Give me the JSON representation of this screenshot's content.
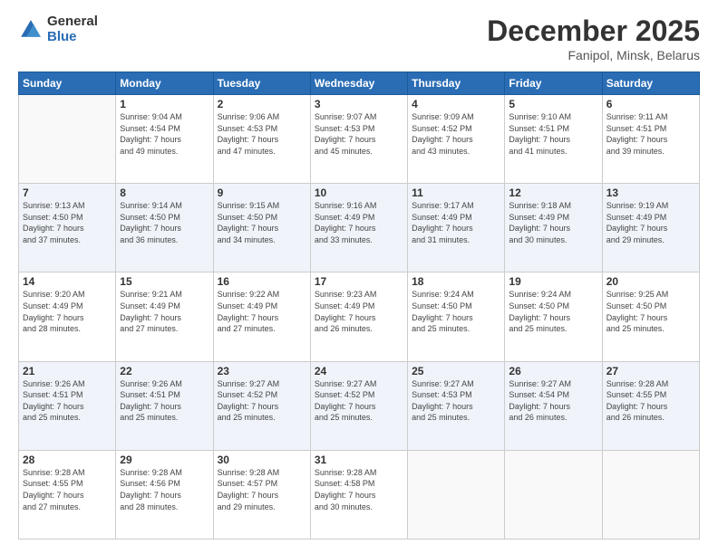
{
  "logo": {
    "general": "General",
    "blue": "Blue"
  },
  "header": {
    "month": "December 2025",
    "location": "Fanipol, Minsk, Belarus"
  },
  "weekdays": [
    "Sunday",
    "Monday",
    "Tuesday",
    "Wednesday",
    "Thursday",
    "Friday",
    "Saturday"
  ],
  "weeks": [
    [
      {
        "day": "",
        "info": ""
      },
      {
        "day": "1",
        "info": "Sunrise: 9:04 AM\nSunset: 4:54 PM\nDaylight: 7 hours\nand 49 minutes."
      },
      {
        "day": "2",
        "info": "Sunrise: 9:06 AM\nSunset: 4:53 PM\nDaylight: 7 hours\nand 47 minutes."
      },
      {
        "day": "3",
        "info": "Sunrise: 9:07 AM\nSunset: 4:53 PM\nDaylight: 7 hours\nand 45 minutes."
      },
      {
        "day": "4",
        "info": "Sunrise: 9:09 AM\nSunset: 4:52 PM\nDaylight: 7 hours\nand 43 minutes."
      },
      {
        "day": "5",
        "info": "Sunrise: 9:10 AM\nSunset: 4:51 PM\nDaylight: 7 hours\nand 41 minutes."
      },
      {
        "day": "6",
        "info": "Sunrise: 9:11 AM\nSunset: 4:51 PM\nDaylight: 7 hours\nand 39 minutes."
      }
    ],
    [
      {
        "day": "7",
        "info": "Sunrise: 9:13 AM\nSunset: 4:50 PM\nDaylight: 7 hours\nand 37 minutes."
      },
      {
        "day": "8",
        "info": "Sunrise: 9:14 AM\nSunset: 4:50 PM\nDaylight: 7 hours\nand 36 minutes."
      },
      {
        "day": "9",
        "info": "Sunrise: 9:15 AM\nSunset: 4:50 PM\nDaylight: 7 hours\nand 34 minutes."
      },
      {
        "day": "10",
        "info": "Sunrise: 9:16 AM\nSunset: 4:49 PM\nDaylight: 7 hours\nand 33 minutes."
      },
      {
        "day": "11",
        "info": "Sunrise: 9:17 AM\nSunset: 4:49 PM\nDaylight: 7 hours\nand 31 minutes."
      },
      {
        "day": "12",
        "info": "Sunrise: 9:18 AM\nSunset: 4:49 PM\nDaylight: 7 hours\nand 30 minutes."
      },
      {
        "day": "13",
        "info": "Sunrise: 9:19 AM\nSunset: 4:49 PM\nDaylight: 7 hours\nand 29 minutes."
      }
    ],
    [
      {
        "day": "14",
        "info": "Sunrise: 9:20 AM\nSunset: 4:49 PM\nDaylight: 7 hours\nand 28 minutes."
      },
      {
        "day": "15",
        "info": "Sunrise: 9:21 AM\nSunset: 4:49 PM\nDaylight: 7 hours\nand 27 minutes."
      },
      {
        "day": "16",
        "info": "Sunrise: 9:22 AM\nSunset: 4:49 PM\nDaylight: 7 hours\nand 27 minutes."
      },
      {
        "day": "17",
        "info": "Sunrise: 9:23 AM\nSunset: 4:49 PM\nDaylight: 7 hours\nand 26 minutes."
      },
      {
        "day": "18",
        "info": "Sunrise: 9:24 AM\nSunset: 4:50 PM\nDaylight: 7 hours\nand 25 minutes."
      },
      {
        "day": "19",
        "info": "Sunrise: 9:24 AM\nSunset: 4:50 PM\nDaylight: 7 hours\nand 25 minutes."
      },
      {
        "day": "20",
        "info": "Sunrise: 9:25 AM\nSunset: 4:50 PM\nDaylight: 7 hours\nand 25 minutes."
      }
    ],
    [
      {
        "day": "21",
        "info": "Sunrise: 9:26 AM\nSunset: 4:51 PM\nDaylight: 7 hours\nand 25 minutes."
      },
      {
        "day": "22",
        "info": "Sunrise: 9:26 AM\nSunset: 4:51 PM\nDaylight: 7 hours\nand 25 minutes."
      },
      {
        "day": "23",
        "info": "Sunrise: 9:27 AM\nSunset: 4:52 PM\nDaylight: 7 hours\nand 25 minutes."
      },
      {
        "day": "24",
        "info": "Sunrise: 9:27 AM\nSunset: 4:52 PM\nDaylight: 7 hours\nand 25 minutes."
      },
      {
        "day": "25",
        "info": "Sunrise: 9:27 AM\nSunset: 4:53 PM\nDaylight: 7 hours\nand 25 minutes."
      },
      {
        "day": "26",
        "info": "Sunrise: 9:27 AM\nSunset: 4:54 PM\nDaylight: 7 hours\nand 26 minutes."
      },
      {
        "day": "27",
        "info": "Sunrise: 9:28 AM\nSunset: 4:55 PM\nDaylight: 7 hours\nand 26 minutes."
      }
    ],
    [
      {
        "day": "28",
        "info": "Sunrise: 9:28 AM\nSunset: 4:55 PM\nDaylight: 7 hours\nand 27 minutes."
      },
      {
        "day": "29",
        "info": "Sunrise: 9:28 AM\nSunset: 4:56 PM\nDaylight: 7 hours\nand 28 minutes."
      },
      {
        "day": "30",
        "info": "Sunrise: 9:28 AM\nSunset: 4:57 PM\nDaylight: 7 hours\nand 29 minutes."
      },
      {
        "day": "31",
        "info": "Sunrise: 9:28 AM\nSunset: 4:58 PM\nDaylight: 7 hours\nand 30 minutes."
      },
      {
        "day": "",
        "info": ""
      },
      {
        "day": "",
        "info": ""
      },
      {
        "day": "",
        "info": ""
      }
    ]
  ]
}
